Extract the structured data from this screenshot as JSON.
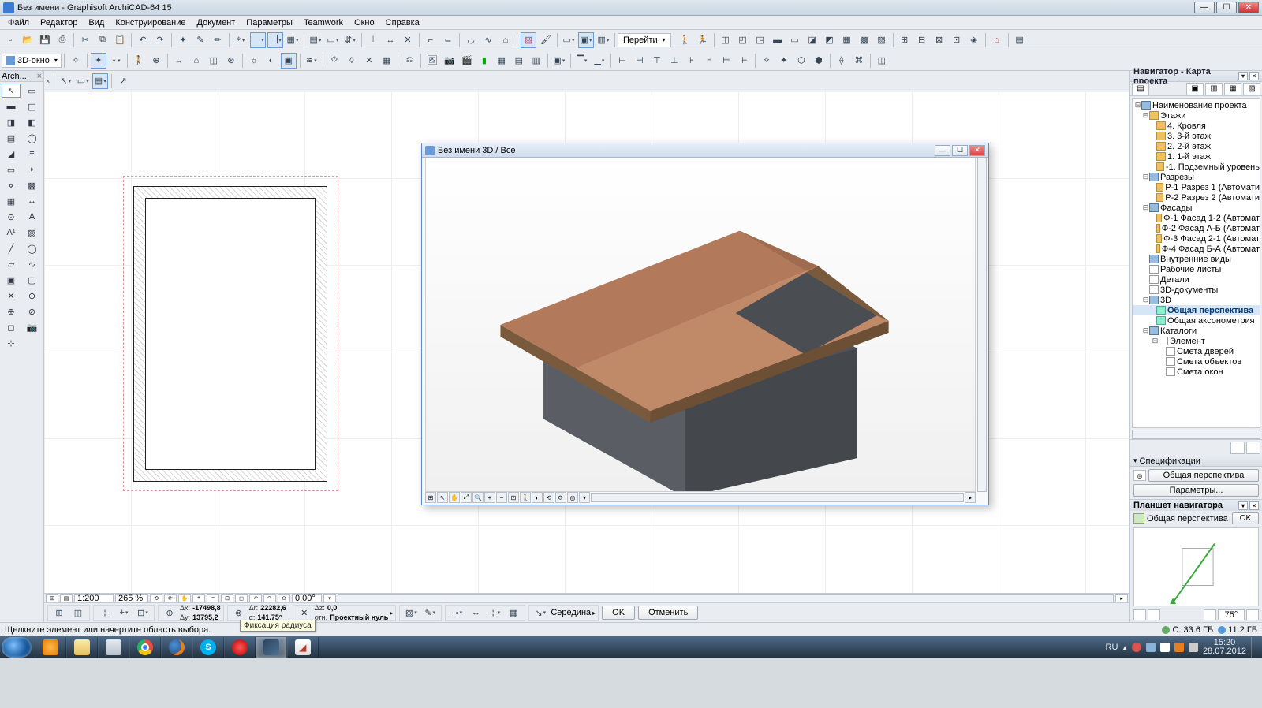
{
  "title": "Без имени - Graphisoft ArchiCAD-64 15",
  "menu": [
    "Файл",
    "Редактор",
    "Вид",
    "Конструирование",
    "Документ",
    "Параметры",
    "Teamwork",
    "Окно",
    "Справка"
  ],
  "toolbar3": {
    "window_mode": "3D-окно"
  },
  "toolbox": {
    "title": "Arch..."
  },
  "child_window": {
    "title": "Без имени 3D / Все"
  },
  "navigator": {
    "title": "Навигатор - Карта проекта",
    "root": "Наименование проекта",
    "floors_root": "Этажи",
    "floors": [
      "4. Кровля",
      "3. 3-й этаж",
      "2. 2-й этаж",
      "1. 1-й этаж",
      "-1. Подземный уровень"
    ],
    "sections_root": "Разрезы",
    "sections": [
      "P-1 Разрез 1 (Автомати",
      "P-2 Разрез 2 (Автомати"
    ],
    "facades_root": "Фасады",
    "facades": [
      "Ф-1 Фасад 1-2 (Автомат",
      "Ф-2 Фасад А-Б (Автомат",
      "Ф-3 Фасад 2-1 (Автомат",
      "Ф-4 Фасад Б-А (Автомат"
    ],
    "inner_views": "Внутренние виды",
    "worksheets": "Рабочие листы",
    "details": "Детали",
    "docs3d": "3D-документы",
    "group3d": "3D",
    "persp": "Общая перспектива",
    "axon": "Общая аксонометрия",
    "catalogs_root": "Каталоги",
    "element": "Элемент",
    "catalogs": [
      "Смета дверей",
      "Смета объектов",
      "Смета окон"
    ],
    "spec_title": "Спецификации",
    "spec_view": "Общая перспектива",
    "params_btn": "Параметры..."
  },
  "planchette": {
    "title": "Планшет навигатора",
    "view": "Общая перспектива",
    "ok": "OK",
    "angle": "75°"
  },
  "bottom": {
    "scale": "1:200",
    "zoom": "265 %",
    "angle": "0.00°"
  },
  "coords": {
    "dx_label": "Δx:",
    "dx": "-17498,8",
    "dy_label": "Δy:",
    "dy": "13795,2",
    "dr_label": "Δr:",
    "dr": "22282,6",
    "da_label": "α:",
    "da": "141,75°",
    "dz_label": "Δz:",
    "dz": "0,0",
    "ref_label": "отн.",
    "ref": "Проектный нуль",
    "snap": "Середина",
    "ok": "OK",
    "cancel": "Отменить",
    "tooltip": "Фиксация радиуса"
  },
  "status": {
    "hint": "Щелкните элемент или начертите область выбора.",
    "disk_c": "C: 33.6 ГБ",
    "disk_d": "11.2 ГБ"
  },
  "tray": {
    "lang": "RU",
    "time": "15:20",
    "date": "28.07.2012"
  }
}
